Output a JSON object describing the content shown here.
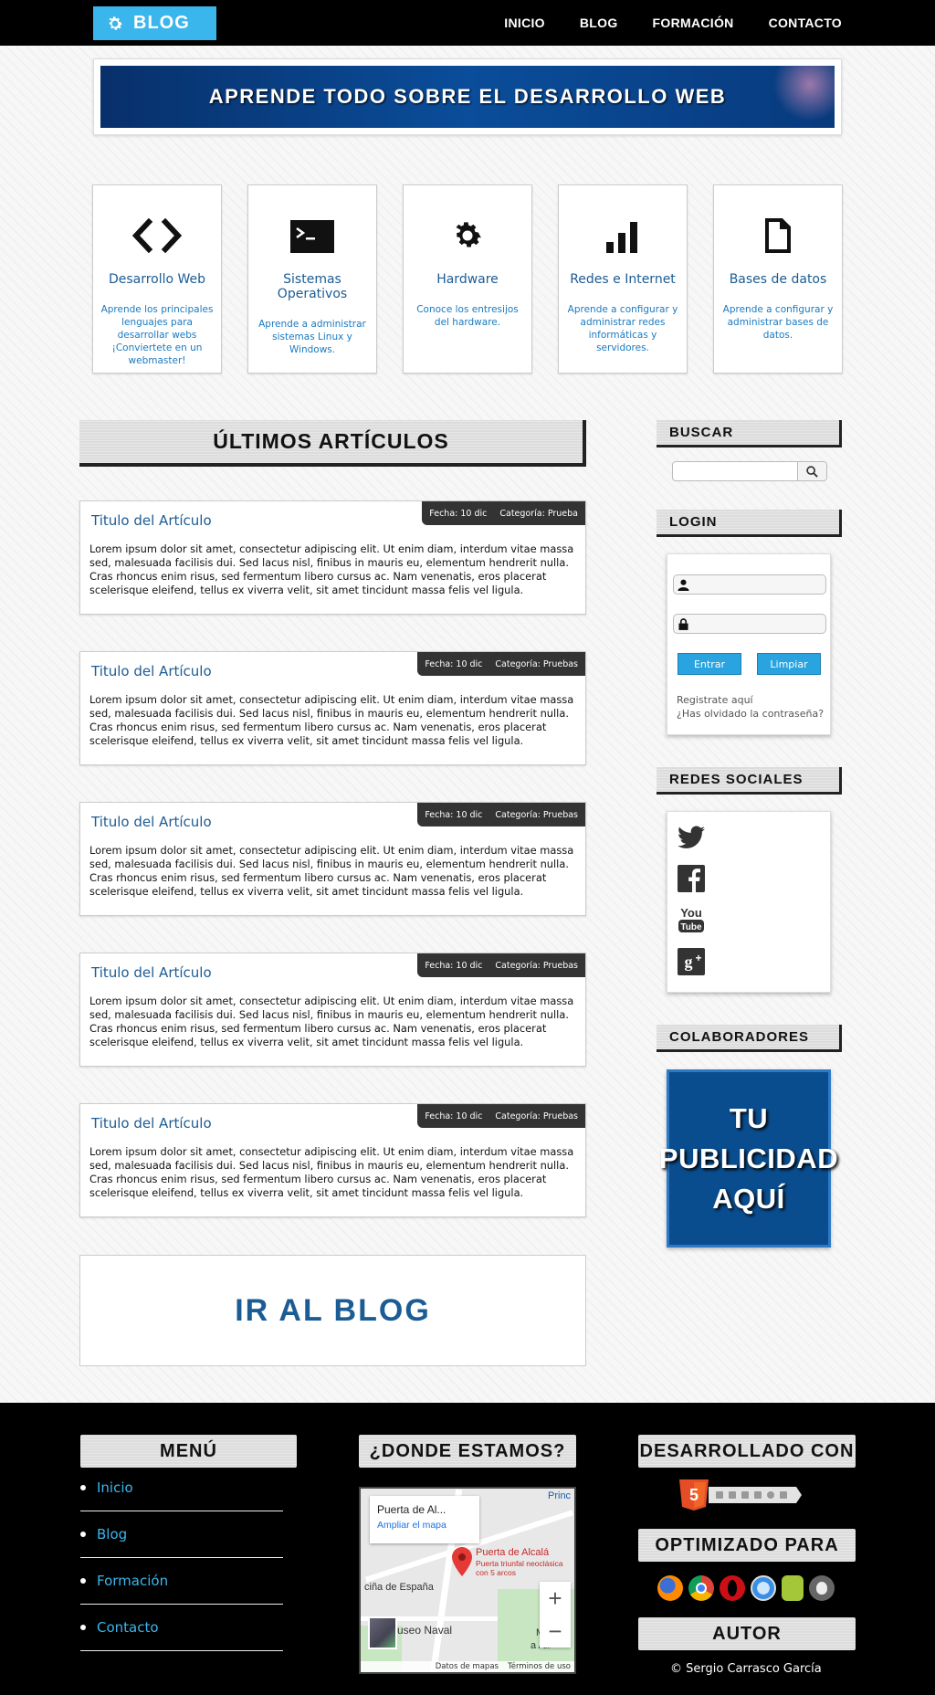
{
  "header": {
    "logo_label": "BLOG",
    "nav": [
      "INICIO",
      "BLOG",
      "FORMACIÓN",
      "CONTACTO"
    ]
  },
  "banner": {
    "text": "APRENDE TODO SOBRE EL DESARROLLO WEB"
  },
  "categories": [
    {
      "icon": "code-icon",
      "title": "Desarrollo Web",
      "desc": "Aprende los principales lenguajes para desarrollar webs ¡Conviertete en un webmaster!"
    },
    {
      "icon": "terminal-icon",
      "title": "Sistemas Operativos",
      "desc": "Aprende a administrar sistemas Linux y Windows."
    },
    {
      "icon": "gear-icon",
      "title": "Hardware",
      "desc": "Conoce los entresijos del hardware."
    },
    {
      "icon": "signal-bars-icon",
      "title": "Redes e Internet",
      "desc": "Aprende a configurar y administrar redes informáticas y servidores."
    },
    {
      "icon": "document-icon",
      "title": "Bases de datos",
      "desc": "Aprende a configurar y administrar bases de datos."
    }
  ],
  "main": {
    "heading": "ÚLTIMOS ARTÍCULOS",
    "articles": [
      {
        "date": "Fecha: 10 dic",
        "category": "Categoría: Prueba",
        "title": "Titulo del Artículo",
        "body": "Lorem ipsum dolor sit amet, consectetur adipiscing elit. Ut enim diam, interdum vitae massa sed, malesuada facilisis dui. Sed lacus nisl, finibus in mauris eu, elementum hendrerit nulla. Cras rhoncus enim risus, sed fermentum libero cursus ac. Nam venenatis, eros placerat scelerisque eleifend, tellus ex viverra velit, sit amet tincidunt massa felis vel ligula."
      },
      {
        "date": "Fecha: 10 dic",
        "category": "Categoría: Pruebas",
        "title": "Titulo del Artículo",
        "body": "Lorem ipsum dolor sit amet, consectetur adipiscing elit. Ut enim diam, interdum vitae massa sed, malesuada facilisis dui. Sed lacus nisl, finibus in mauris eu, elementum hendrerit nulla. Cras rhoncus enim risus, sed fermentum libero cursus ac. Nam venenatis, eros placerat scelerisque eleifend, tellus ex viverra velit, sit amet tincidunt massa felis vel ligula."
      },
      {
        "date": "Fecha: 10 dic",
        "category": "Categoría: Pruebas",
        "title": "Titulo del Artículo",
        "body": "Lorem ipsum dolor sit amet, consectetur adipiscing elit. Ut enim diam, interdum vitae massa sed, malesuada facilisis dui. Sed lacus nisl, finibus in mauris eu, elementum hendrerit nulla. Cras rhoncus enim risus, sed fermentum libero cursus ac. Nam venenatis, eros placerat scelerisque eleifend, tellus ex viverra velit, sit amet tincidunt massa felis vel ligula."
      },
      {
        "date": "Fecha: 10 dic",
        "category": "Categoría: Pruebas",
        "title": "Titulo del Artículo",
        "body": "Lorem ipsum dolor sit amet, consectetur adipiscing elit. Ut enim diam, interdum vitae massa sed, malesuada facilisis dui. Sed lacus nisl, finibus in mauris eu, elementum hendrerit nulla. Cras rhoncus enim risus, sed fermentum libero cursus ac. Nam venenatis, eros placerat scelerisque eleifend, tellus ex viverra velit, sit amet tincidunt massa felis vel ligula."
      },
      {
        "date": "Fecha: 10 dic",
        "category": "Categoría: Pruebas",
        "title": "Titulo del Artículo",
        "body": "Lorem ipsum dolor sit amet, consectetur adipiscing elit. Ut enim diam, interdum vitae massa sed, malesuada facilisis dui. Sed lacus nisl, finibus in mauris eu, elementum hendrerit nulla. Cras rhoncus enim risus, sed fermentum libero cursus ac. Nam venenatis, eros placerat scelerisque eleifend, tellus ex viverra velit, sit amet tincidunt massa felis vel ligula."
      }
    ],
    "goto_blog": "IR AL BLOG"
  },
  "sidebar": {
    "search_heading": "BUSCAR",
    "search_value": "",
    "login_heading": "LOGIN",
    "login_submit": "Entrar",
    "login_clear": "Limpiar",
    "register_link": "Registrate aquí",
    "forgot_link": "¿Has olvidado la contraseña?",
    "social_heading": "REDES SOCIALES",
    "social_icons": [
      "twitter-icon",
      "facebook-icon",
      "youtube-icon",
      "google-plus-icon"
    ],
    "collab_heading": "COLABORADORES",
    "ad_lines": [
      "TU",
      "PUBLICIDAD",
      "AQUÍ"
    ]
  },
  "footer": {
    "menu_heading": "MENÚ",
    "menu_items": [
      "Inicio",
      "Blog",
      "Formación",
      "Contacto"
    ],
    "location_heading": "¿DONDE ESTAMOS?",
    "map": {
      "place_title": "Puerta de Al...",
      "enlarge_link": "Ampliar el mapa",
      "pin_label": "Puerta de Alcalá",
      "pin_sublabel": "Puerta triunfal neoclásica con 5 arcos",
      "street_label": "ciña de España",
      "museum_label": "useo Naval",
      "top_label": "Princ",
      "corner_label": "Mo",
      "corner_label2": "a Alf",
      "attrib_data": "Datos de mapas",
      "attrib_terms": "Términos de uso"
    },
    "built_heading": "DESARROLLADO CON",
    "optimized_heading": "OPTIMIZADO PARA",
    "browser_icons": [
      "firefox-icon",
      "chrome-icon",
      "opera-icon",
      "safari-icon",
      "android-icon",
      "apple-icon"
    ],
    "author_heading": "AUTOR",
    "author": "© Sergio Carrasco García"
  },
  "colors": {
    "accent": "#3ab6ec",
    "link_blue": "#1c5c94",
    "nav_bg": "#000000",
    "ad_bg": "#0a4d8f"
  }
}
